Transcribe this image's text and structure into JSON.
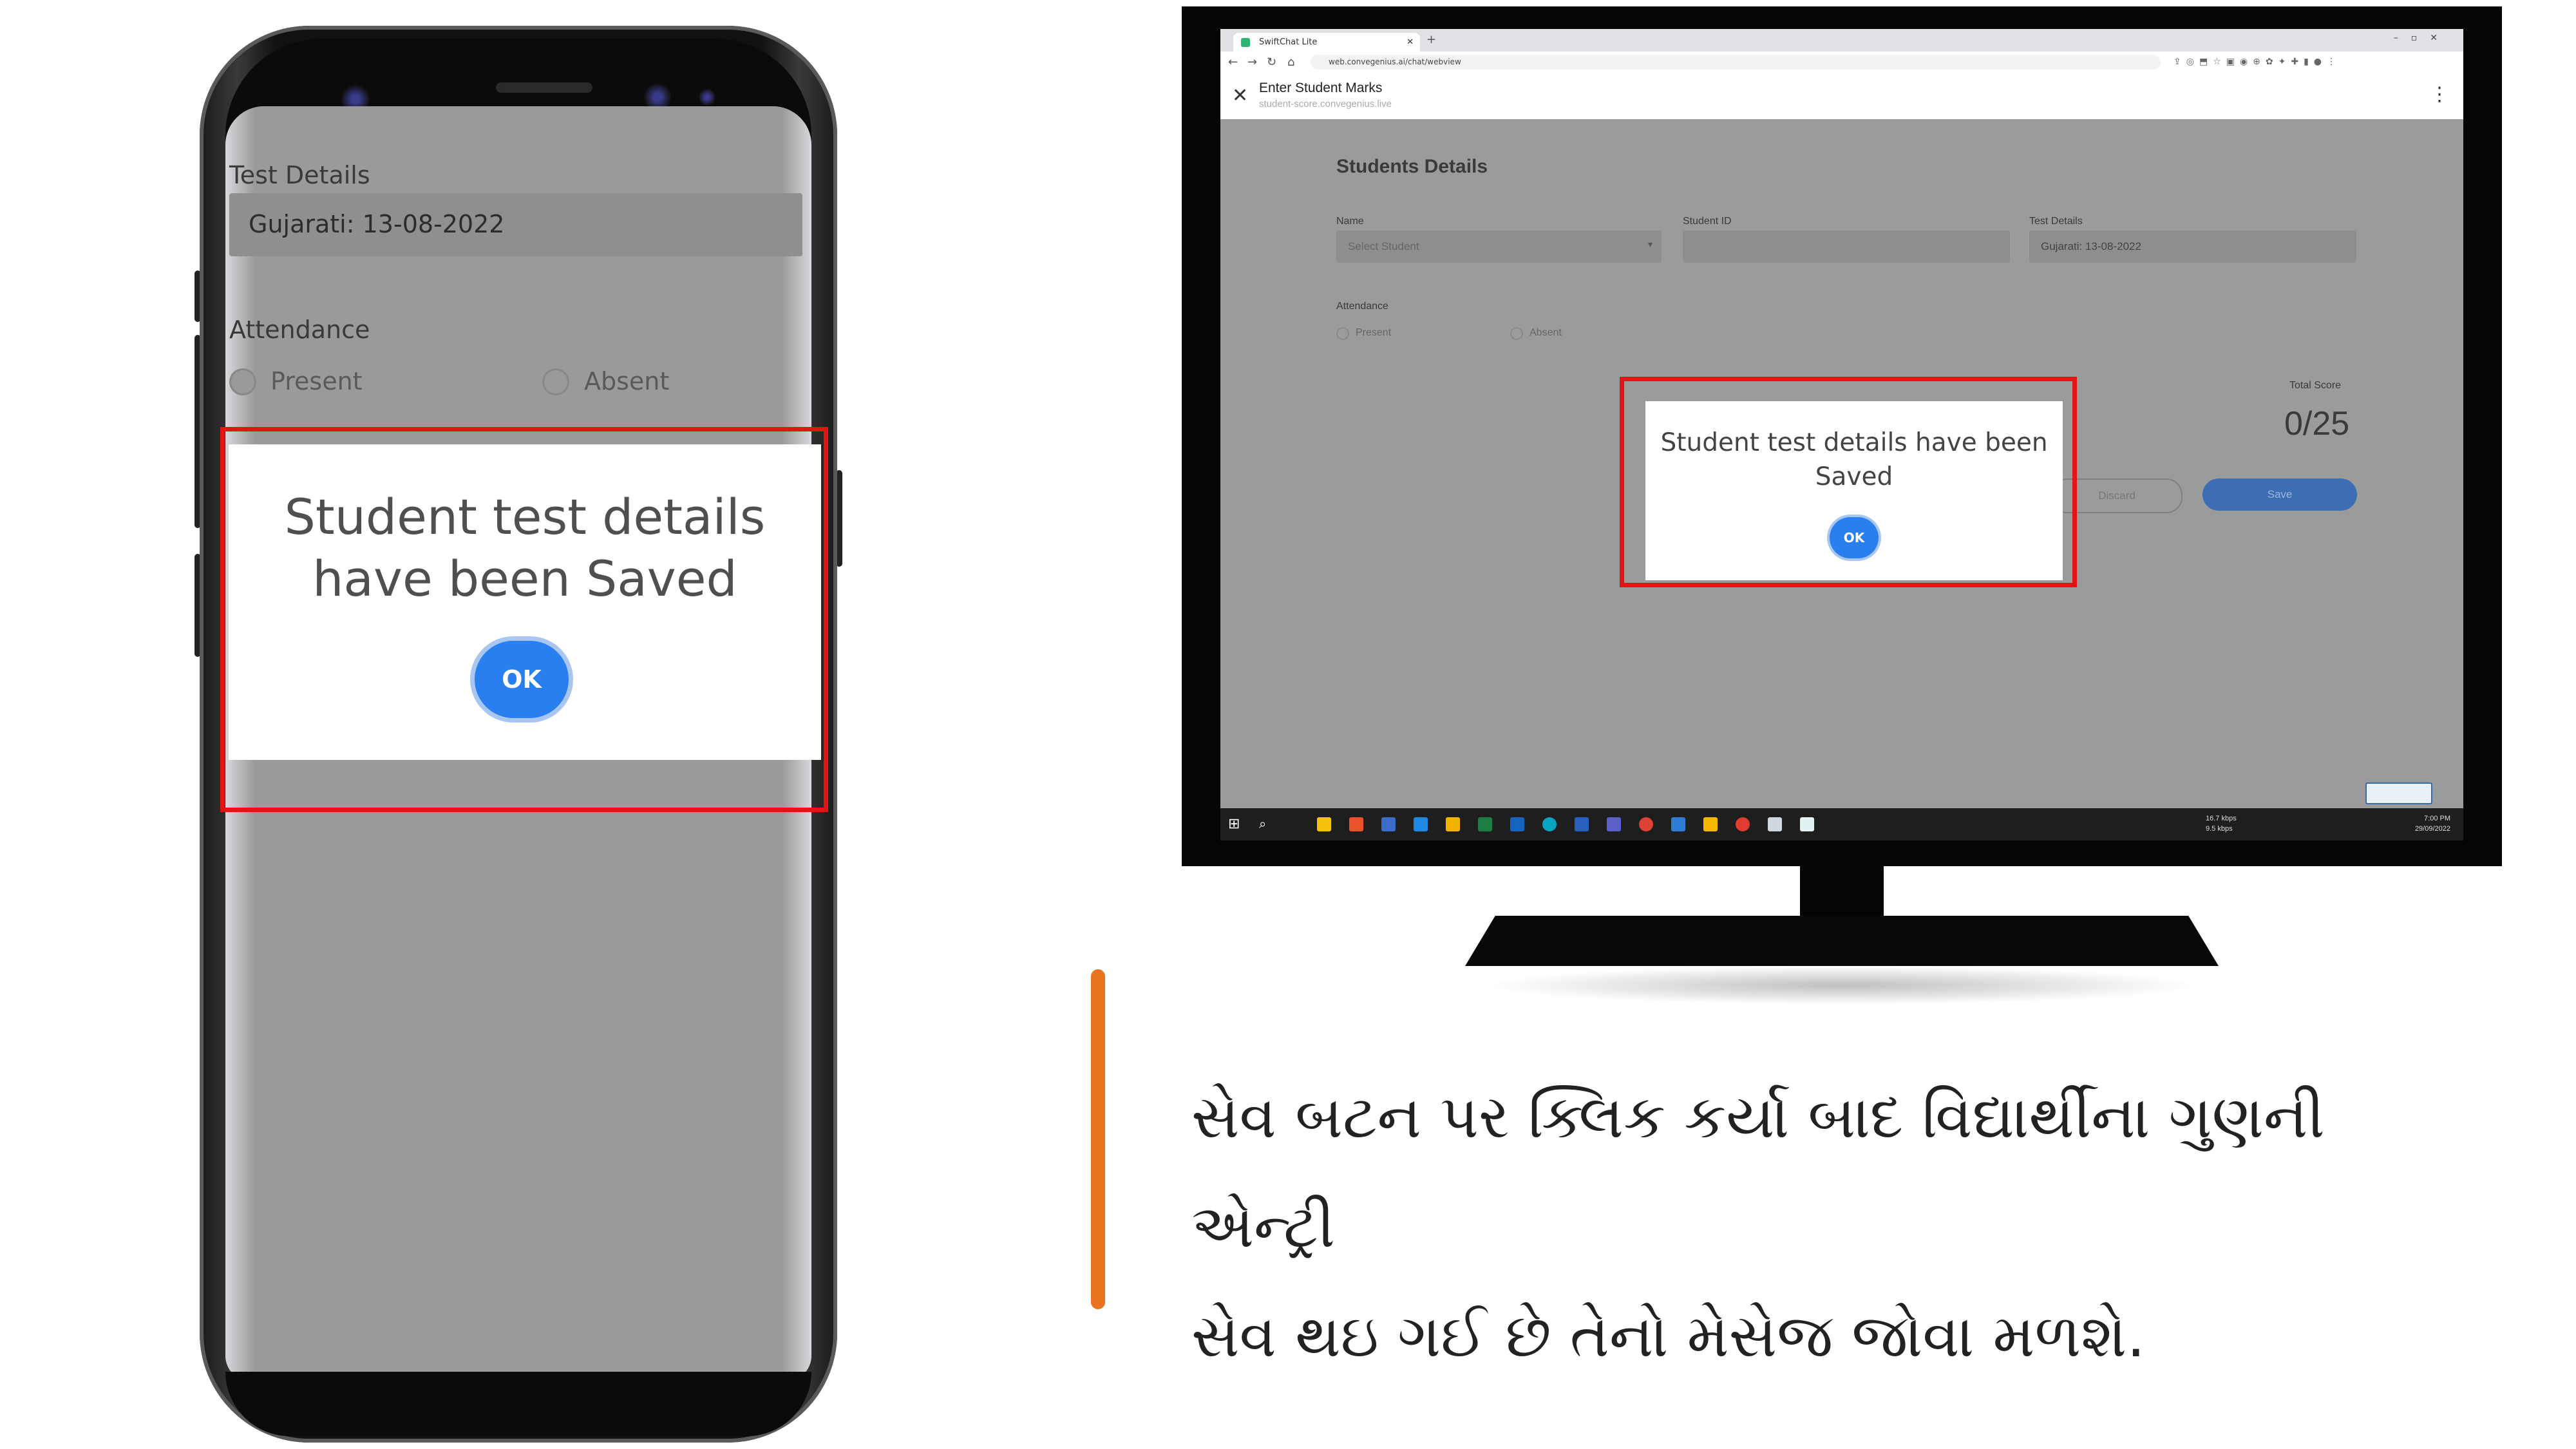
{
  "phone": {
    "test_details_label": "Test Details",
    "test_details_value": "Gujarati: 13-08-2022",
    "attendance_label": "Attendance",
    "present_label": "Present",
    "absent_label": "Absent",
    "dialog_message": "Student test details have been Saved",
    "ok_label": "OK"
  },
  "monitor": {
    "browser_tab_title": "SwiftChat Lite",
    "url": "web.convegenius.ai/chat/webview",
    "webview_title": "Enter Student Marks",
    "webview_subtitle": "student-score.convegenius.live",
    "section_title": "Students Details",
    "name_label": "Name",
    "name_placeholder": "Select Student",
    "student_id_label": "Student ID",
    "test_details_label": "Test Details",
    "test_details_value": "Gujarati: 13-08-2022",
    "attendance_label": "Attendance",
    "present_label": "Present",
    "absent_label": "Absent",
    "total_score_label": "Total Score",
    "total_score_value": "0/25",
    "discard_label": "Discard",
    "save_label": "Save",
    "dialog_message": "Student test details have been Saved",
    "ok_label": "OK",
    "net_up": "16.7 kbps",
    "net_down": "9.5 kbps",
    "clock_time": "7:00 PM",
    "clock_date": "29/09/2022"
  },
  "caption": {
    "line1": "સેવ બટન પર ક્લિક કર્યા બાદ વિદ્યાર્થીના ગુણની એન્ટ્રી",
    "line2": "સેવ થઇ ગઈ છે તેનો મેસેજ જોવા મળશે."
  },
  "colors": {
    "highlight_box": "#e21515",
    "ok_button": "#2a7fef",
    "accent_bar": "#e8741f",
    "overlay_gray": "#9b9b9b"
  }
}
